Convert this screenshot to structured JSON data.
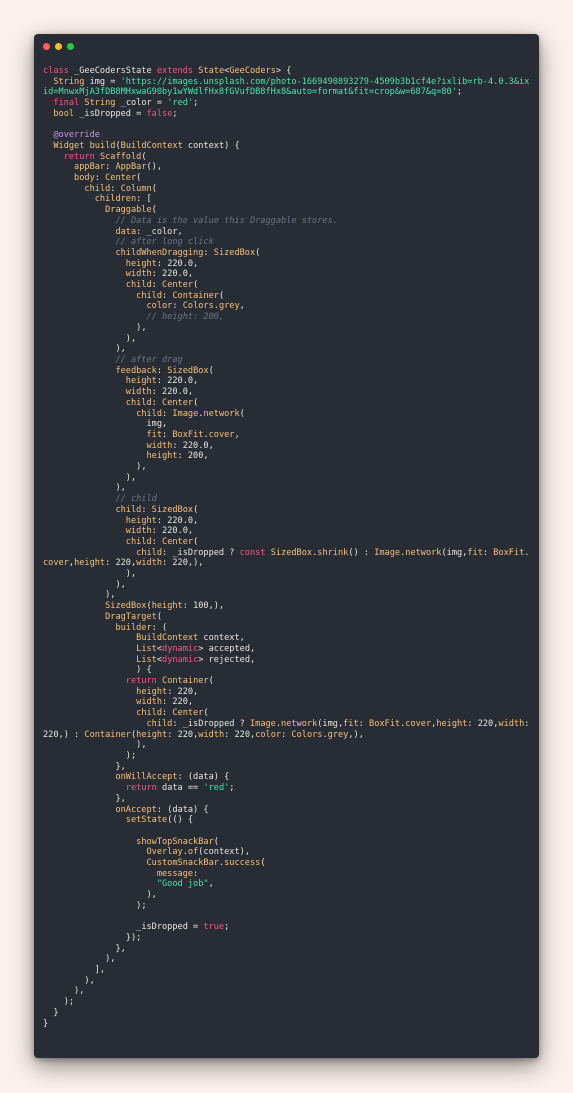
{
  "colors": {
    "background": "#fbf1ec",
    "window": "#282c34",
    "keyword": "#ff4f8b",
    "type": "#f6c177",
    "string": "#47e5b0",
    "comment": "#6c7386",
    "annotation": "#c792ea",
    "text": "#e8e6e3"
  },
  "window_controls": {
    "close": "close-dot",
    "minimize": "minimize-dot",
    "zoom": "zoom-dot"
  },
  "code": {
    "language": "dart",
    "lines": [
      [
        [
          "kw",
          "class"
        ],
        [
          "pl",
          " _GeeCodersState "
        ],
        [
          "kw",
          "extends"
        ],
        [
          "pl",
          " "
        ],
        [
          "ty",
          "State"
        ],
        [
          "pl",
          "<"
        ],
        [
          "ty",
          "GeeCoders"
        ],
        [
          "pl",
          "> {"
        ]
      ],
      [
        [
          "pl",
          "  "
        ],
        [
          "ty",
          "String"
        ],
        [
          "pl",
          " img = "
        ],
        [
          "str",
          "'https://images.unsplash.com/photo-1669490893279-4509b3b1cf4e?ixlib=rb-4.0.3&ixid=MnwxMjA3fDB8MHxwaG90by1wYWdlfHx8fGVufDB8fHx8&auto=format&fit=crop&w=687&q=80'"
        ],
        [
          "pl",
          ";"
        ]
      ],
      [
        [
          "pl",
          "  "
        ],
        [
          "kw",
          "final"
        ],
        [
          "pl",
          " "
        ],
        [
          "ty",
          "String"
        ],
        [
          "pl",
          " _color = "
        ],
        [
          "str",
          "'red'"
        ],
        [
          "pl",
          ";"
        ]
      ],
      [
        [
          "pl",
          "  "
        ],
        [
          "ty",
          "bool"
        ],
        [
          "pl",
          " _isDropped = "
        ],
        [
          "kw",
          "false"
        ],
        [
          "pl",
          ";"
        ]
      ],
      [
        [
          "pl",
          ""
        ]
      ],
      [
        [
          "pl",
          "  "
        ],
        [
          "ann",
          "@override"
        ]
      ],
      [
        [
          "pl",
          "  "
        ],
        [
          "ty",
          "Widget"
        ],
        [
          "pl",
          " "
        ],
        [
          "fn",
          "build"
        ],
        [
          "pl",
          "("
        ],
        [
          "ty",
          "BuildContext"
        ],
        [
          "pl",
          " context) {"
        ]
      ],
      [
        [
          "pl",
          "    "
        ],
        [
          "kw",
          "return"
        ],
        [
          "pl",
          " "
        ],
        [
          "ty",
          "Scaffold"
        ],
        [
          "pl",
          "("
        ]
      ],
      [
        [
          "pl",
          "      "
        ],
        [
          "ty",
          "appBar"
        ],
        [
          "pl",
          ": "
        ],
        [
          "ty",
          "AppBar"
        ],
        [
          "pl",
          "(),"
        ]
      ],
      [
        [
          "pl",
          "      "
        ],
        [
          "ty",
          "body"
        ],
        [
          "pl",
          ": "
        ],
        [
          "ty",
          "Center"
        ],
        [
          "pl",
          "("
        ]
      ],
      [
        [
          "pl",
          "        "
        ],
        [
          "ty",
          "child"
        ],
        [
          "pl",
          ": "
        ],
        [
          "ty",
          "Column"
        ],
        [
          "pl",
          "("
        ]
      ],
      [
        [
          "pl",
          "          "
        ],
        [
          "ty",
          "children"
        ],
        [
          "pl",
          ": ["
        ]
      ],
      [
        [
          "pl",
          "            "
        ],
        [
          "ty",
          "Draggable"
        ],
        [
          "pl",
          "("
        ]
      ],
      [
        [
          "pl",
          "              "
        ],
        [
          "cm",
          "// Data is the value this Draggable stores."
        ]
      ],
      [
        [
          "pl",
          "              "
        ],
        [
          "ty",
          "data"
        ],
        [
          "pl",
          ": _color,"
        ]
      ],
      [
        [
          "pl",
          "              "
        ],
        [
          "cm",
          "// after long click"
        ]
      ],
      [
        [
          "pl",
          "              "
        ],
        [
          "ty",
          "childWhenDragging"
        ],
        [
          "pl",
          ": "
        ],
        [
          "ty",
          "SizedBox"
        ],
        [
          "pl",
          "("
        ]
      ],
      [
        [
          "pl",
          "                "
        ],
        [
          "ty",
          "height"
        ],
        [
          "pl",
          ": 220.0,"
        ]
      ],
      [
        [
          "pl",
          "                "
        ],
        [
          "ty",
          "width"
        ],
        [
          "pl",
          ": 220.0,"
        ]
      ],
      [
        [
          "pl",
          "                "
        ],
        [
          "ty",
          "child"
        ],
        [
          "pl",
          ": "
        ],
        [
          "ty",
          "Center"
        ],
        [
          "pl",
          "("
        ]
      ],
      [
        [
          "pl",
          "                  "
        ],
        [
          "ty",
          "child"
        ],
        [
          "pl",
          ": "
        ],
        [
          "ty",
          "Container"
        ],
        [
          "pl",
          "("
        ]
      ],
      [
        [
          "pl",
          "                    "
        ],
        [
          "ty",
          "color"
        ],
        [
          "pl",
          ": "
        ],
        [
          "ty",
          "Colors"
        ],
        [
          "pl",
          "."
        ],
        [
          "ty",
          "grey"
        ],
        [
          "pl",
          ","
        ]
      ],
      [
        [
          "pl",
          "                    "
        ],
        [
          "cm",
          "// height: 200,"
        ]
      ],
      [
        [
          "pl",
          "                  ),"
        ]
      ],
      [
        [
          "pl",
          "                ),"
        ]
      ],
      [
        [
          "pl",
          "              ),"
        ]
      ],
      [
        [
          "pl",
          "              "
        ],
        [
          "cm",
          "// after drag"
        ]
      ],
      [
        [
          "pl",
          "              "
        ],
        [
          "ty",
          "feedback"
        ],
        [
          "pl",
          ": "
        ],
        [
          "ty",
          "SizedBox"
        ],
        [
          "pl",
          "("
        ]
      ],
      [
        [
          "pl",
          "                "
        ],
        [
          "ty",
          "height"
        ],
        [
          "pl",
          ": 220.0,"
        ]
      ],
      [
        [
          "pl",
          "                "
        ],
        [
          "ty",
          "width"
        ],
        [
          "pl",
          ": 220.0,"
        ]
      ],
      [
        [
          "pl",
          "                "
        ],
        [
          "ty",
          "child"
        ],
        [
          "pl",
          ": "
        ],
        [
          "ty",
          "Center"
        ],
        [
          "pl",
          "("
        ]
      ],
      [
        [
          "pl",
          "                  "
        ],
        [
          "ty",
          "child"
        ],
        [
          "pl",
          ": "
        ],
        [
          "ty",
          "Image"
        ],
        [
          "pl",
          "."
        ],
        [
          "fn",
          "network"
        ],
        [
          "pl",
          "("
        ]
      ],
      [
        [
          "pl",
          "                    img,"
        ]
      ],
      [
        [
          "pl",
          "                    "
        ],
        [
          "ty",
          "fit"
        ],
        [
          "pl",
          ": "
        ],
        [
          "ty",
          "BoxFit"
        ],
        [
          "pl",
          "."
        ],
        [
          "ty",
          "cover"
        ],
        [
          "pl",
          ","
        ]
      ],
      [
        [
          "pl",
          "                    "
        ],
        [
          "ty",
          "width"
        ],
        [
          "pl",
          ": 220.0,"
        ]
      ],
      [
        [
          "pl",
          "                    "
        ],
        [
          "ty",
          "height"
        ],
        [
          "pl",
          ": 200,"
        ]
      ],
      [
        [
          "pl",
          "                  ),"
        ]
      ],
      [
        [
          "pl",
          "                ),"
        ]
      ],
      [
        [
          "pl",
          "              ),"
        ]
      ],
      [
        [
          "pl",
          "              "
        ],
        [
          "cm",
          "// child"
        ]
      ],
      [
        [
          "pl",
          "              "
        ],
        [
          "ty",
          "child"
        ],
        [
          "pl",
          ": "
        ],
        [
          "ty",
          "SizedBox"
        ],
        [
          "pl",
          "("
        ]
      ],
      [
        [
          "pl",
          "                "
        ],
        [
          "ty",
          "height"
        ],
        [
          "pl",
          ": 220.0,"
        ]
      ],
      [
        [
          "pl",
          "                "
        ],
        [
          "ty",
          "width"
        ],
        [
          "pl",
          ": 220.0,"
        ]
      ],
      [
        [
          "pl",
          "                "
        ],
        [
          "ty",
          "child"
        ],
        [
          "pl",
          ": "
        ],
        [
          "ty",
          "Center"
        ],
        [
          "pl",
          "("
        ]
      ],
      [
        [
          "pl",
          "                  "
        ],
        [
          "ty",
          "child"
        ],
        [
          "pl",
          ": _isDropped ? "
        ],
        [
          "kw",
          "const"
        ],
        [
          "pl",
          " "
        ],
        [
          "ty",
          "SizedBox"
        ],
        [
          "pl",
          "."
        ],
        [
          "fn",
          "shrink"
        ],
        [
          "pl",
          "() : "
        ],
        [
          "ty",
          "Image"
        ],
        [
          "pl",
          "."
        ],
        [
          "fn",
          "network"
        ],
        [
          "pl",
          "(img,"
        ],
        [
          "ty",
          "fit"
        ],
        [
          "pl",
          ": "
        ],
        [
          "ty",
          "BoxFit"
        ],
        [
          "pl",
          "."
        ],
        [
          "ty",
          "cover"
        ],
        [
          "pl",
          ","
        ],
        [
          "ty",
          "height"
        ],
        [
          "pl",
          ": 220,"
        ],
        [
          "ty",
          "width"
        ],
        [
          "pl",
          ": 220,),"
        ]
      ],
      [
        [
          "pl",
          "                ),"
        ]
      ],
      [
        [
          "pl",
          "              ),"
        ]
      ],
      [
        [
          "pl",
          "            ),"
        ]
      ],
      [
        [
          "pl",
          "            "
        ],
        [
          "ty",
          "SizedBox"
        ],
        [
          "pl",
          "("
        ],
        [
          "ty",
          "height"
        ],
        [
          "pl",
          ": 100,),"
        ]
      ],
      [
        [
          "pl",
          "            "
        ],
        [
          "ty",
          "DragTarget"
        ],
        [
          "pl",
          "("
        ]
      ],
      [
        [
          "pl",
          "              "
        ],
        [
          "ty",
          "builder"
        ],
        [
          "pl",
          ": ("
        ]
      ],
      [
        [
          "pl",
          "                  "
        ],
        [
          "ty",
          "BuildContext"
        ],
        [
          "pl",
          " context,"
        ]
      ],
      [
        [
          "pl",
          "                  "
        ],
        [
          "ty",
          "List"
        ],
        [
          "pl",
          "<"
        ],
        [
          "kw",
          "dynamic"
        ],
        [
          "pl",
          "> accepted,"
        ]
      ],
      [
        [
          "pl",
          "                  "
        ],
        [
          "ty",
          "List"
        ],
        [
          "pl",
          "<"
        ],
        [
          "kw",
          "dynamic"
        ],
        [
          "pl",
          "> rejected,"
        ]
      ],
      [
        [
          "pl",
          "                  ) {"
        ]
      ],
      [
        [
          "pl",
          "                "
        ],
        [
          "kw",
          "return"
        ],
        [
          "pl",
          " "
        ],
        [
          "ty",
          "Container"
        ],
        [
          "pl",
          "("
        ]
      ],
      [
        [
          "pl",
          "                  "
        ],
        [
          "ty",
          "height"
        ],
        [
          "pl",
          ": 220,"
        ]
      ],
      [
        [
          "pl",
          "                  "
        ],
        [
          "ty",
          "width"
        ],
        [
          "pl",
          ": 220,"
        ]
      ],
      [
        [
          "pl",
          "                  "
        ],
        [
          "ty",
          "child"
        ],
        [
          "pl",
          ": "
        ],
        [
          "ty",
          "Center"
        ],
        [
          "pl",
          "("
        ]
      ],
      [
        [
          "pl",
          "                    "
        ],
        [
          "ty",
          "child"
        ],
        [
          "pl",
          ": _isDropped ? "
        ],
        [
          "ty",
          "Image"
        ],
        [
          "pl",
          "."
        ],
        [
          "fn",
          "network"
        ],
        [
          "pl",
          "(img,"
        ],
        [
          "ty",
          "fit"
        ],
        [
          "pl",
          ": "
        ],
        [
          "ty",
          "BoxFit"
        ],
        [
          "pl",
          "."
        ],
        [
          "ty",
          "cover"
        ],
        [
          "pl",
          ","
        ],
        [
          "ty",
          "height"
        ],
        [
          "pl",
          ": 220,"
        ],
        [
          "ty",
          "width"
        ],
        [
          "pl",
          ": 220,) : "
        ],
        [
          "ty",
          "Container"
        ],
        [
          "pl",
          "("
        ],
        [
          "ty",
          "height"
        ],
        [
          "pl",
          ": 220,"
        ],
        [
          "ty",
          "width"
        ],
        [
          "pl",
          ": 220,"
        ],
        [
          "ty",
          "color"
        ],
        [
          "pl",
          ": "
        ],
        [
          "ty",
          "Colors"
        ],
        [
          "pl",
          "."
        ],
        [
          "ty",
          "grey"
        ],
        [
          "pl",
          ",),"
        ]
      ],
      [
        [
          "pl",
          "                  ),"
        ]
      ],
      [
        [
          "pl",
          "                );"
        ]
      ],
      [
        [
          "pl",
          "              },"
        ]
      ],
      [
        [
          "pl",
          "              "
        ],
        [
          "ty",
          "onWillAccept"
        ],
        [
          "pl",
          ": (data) {"
        ]
      ],
      [
        [
          "pl",
          "                "
        ],
        [
          "kw",
          "return"
        ],
        [
          "pl",
          " data == "
        ],
        [
          "str",
          "'red'"
        ],
        [
          "pl",
          ";"
        ]
      ],
      [
        [
          "pl",
          "              },"
        ]
      ],
      [
        [
          "pl",
          "              "
        ],
        [
          "ty",
          "onAccept"
        ],
        [
          "pl",
          ": (data) {"
        ]
      ],
      [
        [
          "pl",
          "                "
        ],
        [
          "fn",
          "setState"
        ],
        [
          "pl",
          "(() {"
        ]
      ],
      [
        [
          "pl",
          ""
        ]
      ],
      [
        [
          "pl",
          "                  "
        ],
        [
          "fn",
          "showTopSnackBar"
        ],
        [
          "pl",
          "("
        ]
      ],
      [
        [
          "pl",
          "                    "
        ],
        [
          "ty",
          "Overlay"
        ],
        [
          "pl",
          "."
        ],
        [
          "fn",
          "of"
        ],
        [
          "pl",
          "(context),"
        ]
      ],
      [
        [
          "pl",
          "                    "
        ],
        [
          "ty",
          "CustomSnackBar"
        ],
        [
          "pl",
          "."
        ],
        [
          "fn",
          "success"
        ],
        [
          "pl",
          "("
        ]
      ],
      [
        [
          "pl",
          "                      "
        ],
        [
          "ty",
          "message"
        ],
        [
          "pl",
          ":"
        ]
      ],
      [
        [
          "pl",
          "                      "
        ],
        [
          "str",
          "\"Good job\""
        ],
        [
          "pl",
          ","
        ]
      ],
      [
        [
          "pl",
          "                    ),"
        ]
      ],
      [
        [
          "pl",
          "                  );"
        ]
      ],
      [
        [
          "pl",
          ""
        ]
      ],
      [
        [
          "pl",
          "                  _isDropped = "
        ],
        [
          "kw",
          "true"
        ],
        [
          "pl",
          ";"
        ]
      ],
      [
        [
          "pl",
          "                });"
        ]
      ],
      [
        [
          "pl",
          "              },"
        ]
      ],
      [
        [
          "pl",
          "            ),"
        ]
      ],
      [
        [
          "pl",
          "          ],"
        ]
      ],
      [
        [
          "pl",
          "        ),"
        ]
      ],
      [
        [
          "pl",
          "      ),"
        ]
      ],
      [
        [
          "pl",
          "    );"
        ]
      ],
      [
        [
          "pl",
          "  }"
        ]
      ],
      [
        [
          "pl",
          "}"
        ]
      ]
    ]
  }
}
